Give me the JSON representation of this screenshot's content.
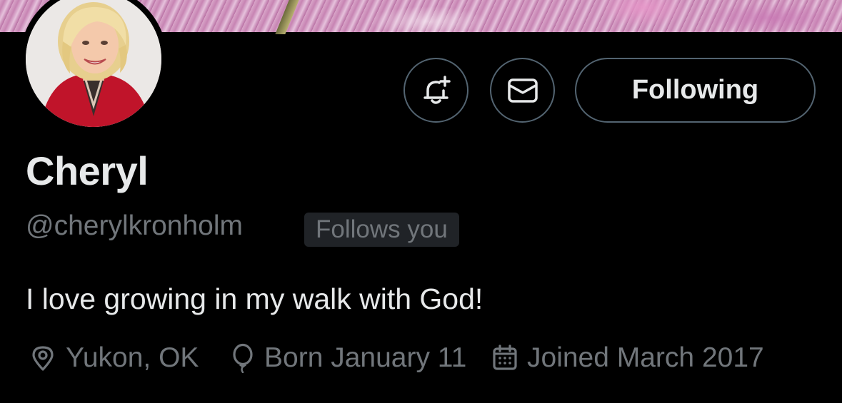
{
  "profile": {
    "display_name": "Cheryl",
    "handle": "@cherylkronholm",
    "follows_you_badge": "Follows you",
    "bio": "I love growing in my walk with God!",
    "location": "Yukon, OK",
    "birthday": "Born January 11",
    "joined": "Joined March 2017"
  },
  "actions": {
    "notify_icon": "bell-plus-icon",
    "message_icon": "envelope-icon",
    "follow_label": "Following"
  },
  "icons": {
    "location": "map-pin-icon",
    "birthday": "balloon-icon",
    "joined": "calendar-icon"
  },
  "colors": {
    "background": "#000000",
    "text_primary": "#e7e9ea",
    "text_secondary": "#71767b",
    "border": "#536471",
    "badge_bg": "#202327"
  }
}
